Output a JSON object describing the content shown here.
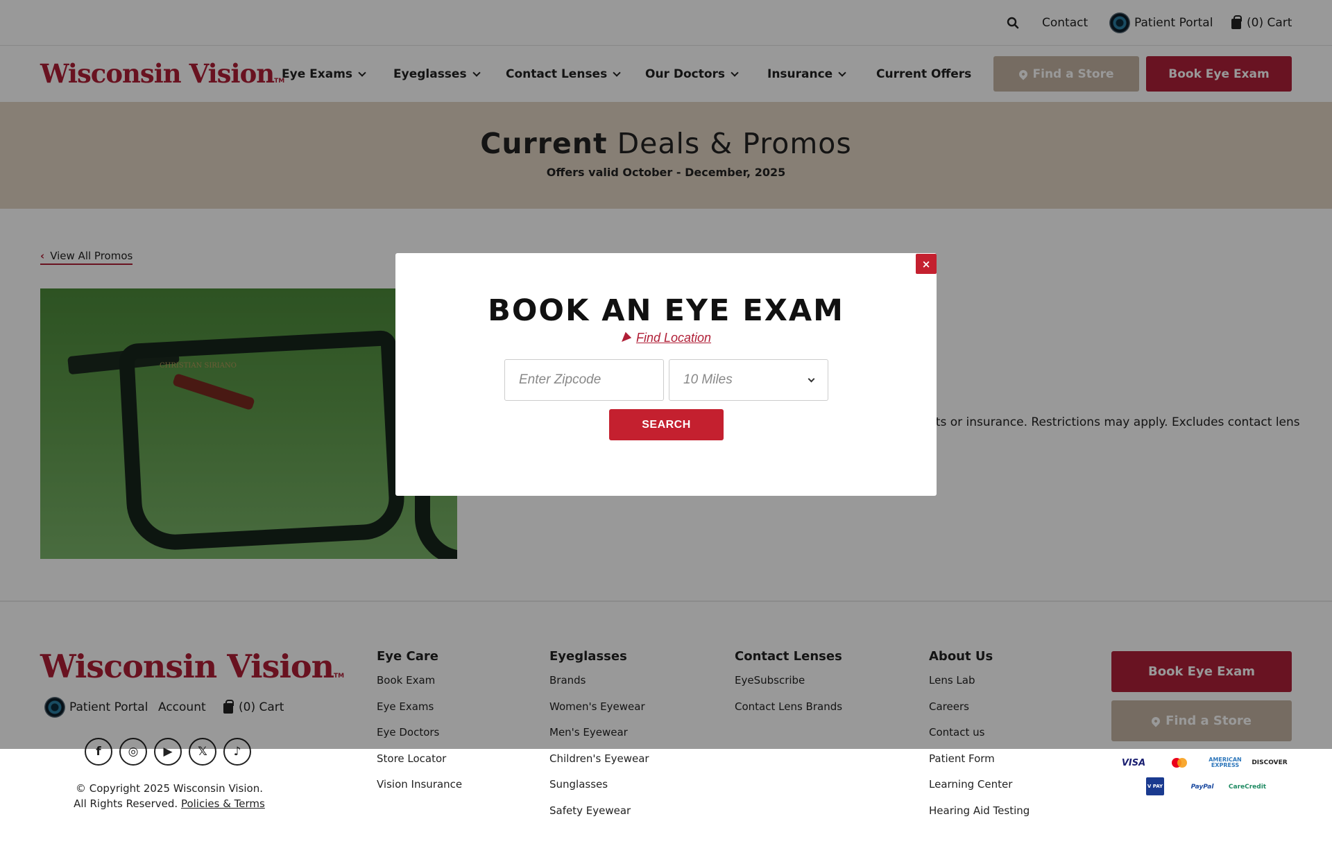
{
  "topbar": {
    "contact": "Contact",
    "patient_portal": "Patient Portal",
    "cart": "(0) Cart"
  },
  "header": {
    "logo": "Wisconsin Vision",
    "logo_tm": "TM",
    "nav": [
      "Eye Exams",
      "Eyeglasses",
      "Contact Lenses",
      "Our Doctors",
      "Insurance",
      "Current Offers"
    ],
    "find_store": "Find a Store",
    "book_exam": "Book Eye Exam"
  },
  "hero": {
    "title_bold": "Current",
    "title_rest": " Deals & Promos",
    "subtitle": "Offers valid October - December, 2025"
  },
  "content": {
    "back_link": "View All Promos",
    "image_brand": "CHRISTIAN SIRIANO",
    "promo_text_fragment": "nts or insurance. Restrictions may apply. Excludes contact lens"
  },
  "modal": {
    "close": "×",
    "title": "BOOK AN EYE EXAM",
    "find_location": "Find Location",
    "zip_placeholder": "Enter Zipcode",
    "radius": "10 Miles",
    "search": "SEARCH"
  },
  "footer": {
    "logo": "Wisconsin Vision",
    "logo_tm": "TM",
    "patient_portal": "Patient Portal",
    "account": "Account",
    "cart": "(0) Cart",
    "social": [
      "f",
      "◎",
      "▶",
      "𝕏",
      "♪"
    ],
    "copyright": "© Copyright 2025 Wisconsin Vision.",
    "rights": "All Rights Reserved.",
    "terms": "Policies & Terms",
    "columns": [
      {
        "title": "Eye Care",
        "links": [
          "Book Exam",
          "Eye Exams",
          "Eye Doctors",
          "Store Locator",
          "Vision Insurance"
        ]
      },
      {
        "title": "Eyeglasses",
        "links": [
          "Brands",
          "Women's Eyewear",
          "Men's Eyewear",
          "Children's Eyewear",
          "Sunglasses",
          "Safety Eyewear"
        ]
      },
      {
        "title": "Contact Lenses",
        "links": [
          "EyeSubscribe",
          "Contact Lens Brands"
        ]
      },
      {
        "title": "About Us",
        "links": [
          "Lens Lab",
          "Careers",
          "Contact us",
          "Patient Form",
          "Learning Center",
          "Hearing Aid Testing"
        ]
      }
    ],
    "book_exam": "Book Eye Exam",
    "find_store": "Find a Store",
    "payments": {
      "visa": "VISA",
      "amex": "AMERICAN EXPRESS",
      "discover": "DISCOVER",
      "vpay": "V PAY",
      "paypal": "PayPal",
      "carecredit": "CareCredit"
    }
  },
  "colors": {
    "brand_red": "#b01e36",
    "tan": "#c5b5a3",
    "hero_bg": "#e2d4c4",
    "mastercard_red": "#eb001b",
    "mastercard_orange": "#f79e1b"
  }
}
